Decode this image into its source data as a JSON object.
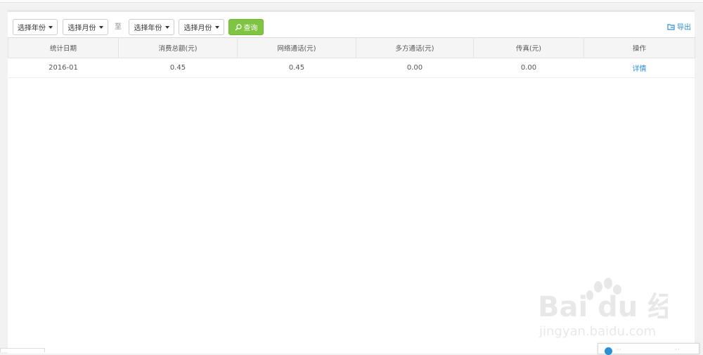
{
  "filters": {
    "start_year": "选择年份",
    "start_month": "选择月份",
    "to": "至",
    "end_year": "选择年份",
    "end_month": "选择月份",
    "query": "查询"
  },
  "export": "导出",
  "table": {
    "headers": [
      "统计日期",
      "消费总额(元)",
      "网络通话(元)",
      "多方通话(元)",
      "传真(元)",
      "操作"
    ],
    "rows": [
      [
        "2016-01",
        "0.45",
        "0.45",
        "0.00",
        "0.00",
        "详情"
      ]
    ]
  },
  "watermark": {
    "brand": "Bai du 经验",
    "url": "jingyan.baidu.com"
  },
  "colors": {
    "accent_green": "#7fc442",
    "link_blue": "#2a8fd6"
  }
}
